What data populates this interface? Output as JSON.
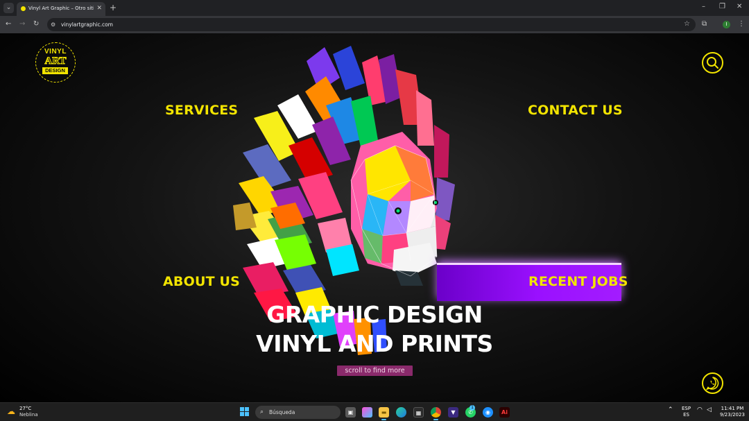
{
  "browser": {
    "tab_title": "Vinyl Art Graphic – Otro sitio r...",
    "url": "vinylartgraphic.com",
    "profile_initial": "I"
  },
  "logo": {
    "line1": "VINYL",
    "line2": "ART",
    "line3": "DESIGN"
  },
  "nav": {
    "services": "SERVICES",
    "contact": "CONTACT US",
    "about": "ABOUT US",
    "recent": "RECENT JOBS"
  },
  "hero": {
    "line1": "GRAPHIC DESIGN",
    "line2": "VINYL AND PRINTS",
    "scroll_label": "scroll to find more"
  },
  "taskbar": {
    "weather_temp": "27°C",
    "weather_desc": "Neblina",
    "search_placeholder": "Búsqueda",
    "language": "ESP",
    "language_region": "ES",
    "time": "11:41 PM",
    "date": "9/23/2023",
    "whatsapp_badge": "1"
  },
  "colors": {
    "accent_yellow": "#f2e400",
    "recent_jobs_purple": "#9a10ff",
    "scroll_pill": "#8a2a6b"
  }
}
